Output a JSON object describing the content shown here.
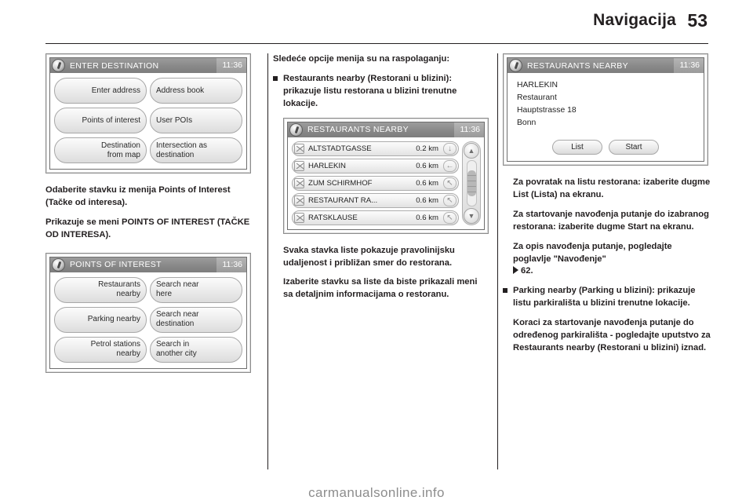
{
  "header": {
    "title": "Navigacija",
    "page_number": "53"
  },
  "footer": {
    "site": "carmanualsonline.info"
  },
  "screens": {
    "enter_destination": {
      "title": "ENTER DESTINATION",
      "clock": "11:36",
      "buttons": [
        {
          "left": "Enter address",
          "right": "Address book"
        },
        {
          "left": "Points of interest",
          "right": "User POIs"
        },
        {
          "left": "Destination\nfrom map",
          "right": "Intersection as\ndestination"
        }
      ],
      "flat": [
        "Enter address",
        "Address book",
        "Points of interest",
        "User POIs",
        "Destination from map",
        "Intersection as destination"
      ]
    },
    "points_of_interest": {
      "title": "POINTS OF INTEREST",
      "clock": "11:36",
      "flat": [
        "Restaurants nearby",
        "Search near here",
        "Parking nearby",
        "Search near destination",
        "Petrol stations nearby",
        "Search in another city"
      ]
    },
    "restaurants_list": {
      "title": "RESTAURANTS NEARBY",
      "clock": "11:36",
      "rows": [
        {
          "name": "ALTSTADTGASSE",
          "distance": "0.2 km",
          "direction": "↓"
        },
        {
          "name": "HARLEKIN",
          "distance": "0.6 km",
          "direction": "←"
        },
        {
          "name": "ZUM SCHIRMHOF",
          "distance": "0.6 km",
          "direction": "↖"
        },
        {
          "name": "RESTAURANT RA...",
          "distance": "0.6 km",
          "direction": "↖"
        },
        {
          "name": "RATSKLAUSE",
          "distance": "0.6 km",
          "direction": "↖"
        }
      ],
      "scroll_up": "▲",
      "scroll_down": "▼"
    },
    "restaurant_detail": {
      "title": "RESTAURANTS NEARBY",
      "clock": "11:36",
      "lines": [
        "HARLEKIN",
        "Restaurant",
        "Hauptstrasse 18",
        "Bonn"
      ],
      "button_list": "List",
      "button_start": "Start"
    }
  },
  "col1": {
    "p1": "Odaberite stavku iz menija Points of Interest (Tačke od interesa).",
    "p2": "Prikazuje se meni POINTS OF INTEREST (TAČKE OD INTERESA)."
  },
  "col2": {
    "intro": "Sledeće opcije menija su na raspolaganju:",
    "bullet1": "Restaurants nearby (Restorani u blizini): prikazuje listu restorana u blizini trenutne lokacije.",
    "p1": "Svaka stavka liste pokazuje pravolinijsku udaljenost i približan smer do restorana.",
    "p2": "Izaberite stavku sa liste da biste prikazali meni sa detaljnim informacijama o restoranu."
  },
  "col3": {
    "p1": "Za povratak na listu restorana: izaberite dugme List (Lista) na ekranu.",
    "p2": "Za startovanje navođenja putanje do izabranog restorana: izaberite dugme Start na ekranu.",
    "p3": "Za opis navođenja putanje, pogledajte poglavlje \"Navođenje\"",
    "p3_ref": "62.",
    "bullet1": "Parking nearby (Parking u blizini): prikazuje listu parkirališta u blizini trenutne lokacije.",
    "p4": "Koraci za startovanje navođenja putanje do određenog parkirališta - pogledajte uputstvo za Restaurants nearby (Restorani u blizini) iznad."
  }
}
